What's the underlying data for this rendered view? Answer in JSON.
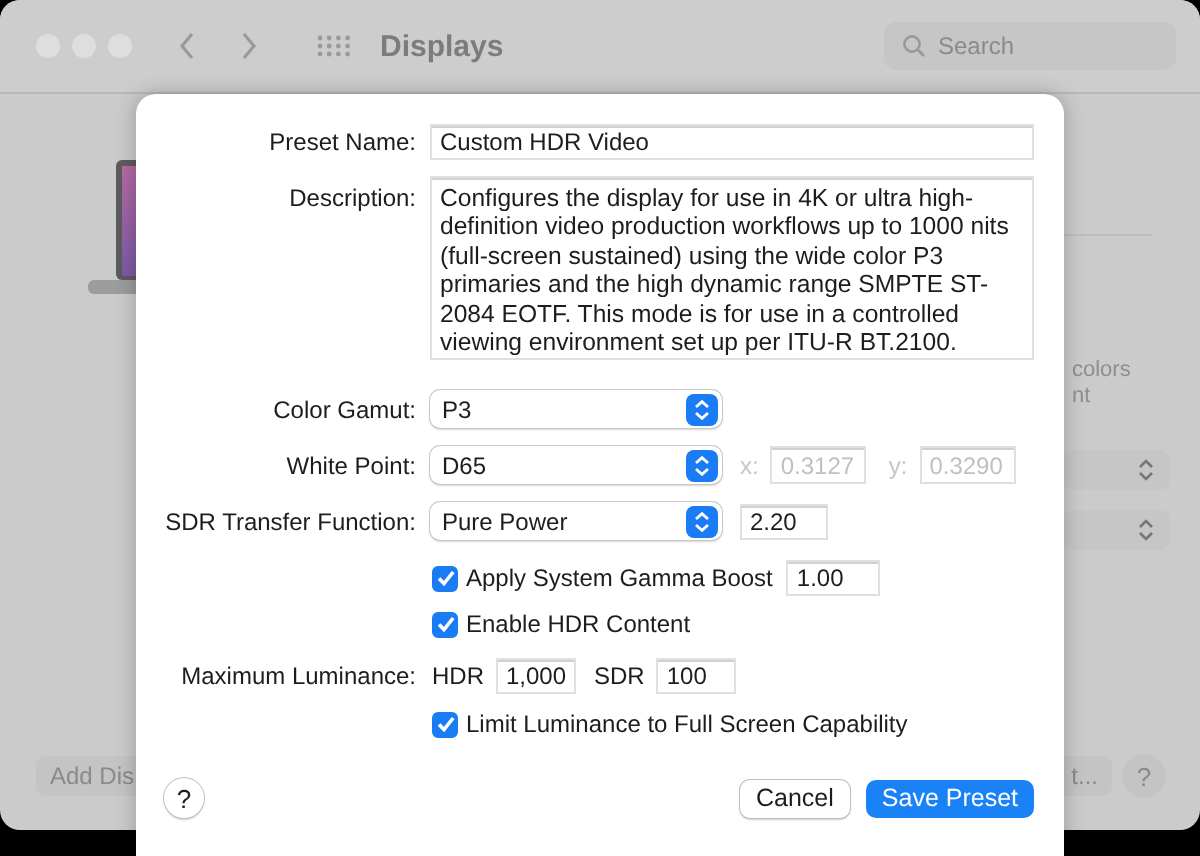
{
  "window": {
    "title": "Displays",
    "search": {
      "placeholder": "Search"
    }
  },
  "background": {
    "texts": [
      "colors",
      "nt"
    ],
    "buttons": [
      "Add Dis",
      "t..."
    ],
    "help": "?"
  },
  "dialog": {
    "preset_name": {
      "label": "Preset Name:",
      "value": "Custom HDR Video"
    },
    "description": {
      "label": "Description:",
      "value": "Configures the display for use in 4K or ultra high-definition video production workflows up to 1000 nits (full-screen sustained) using the wide color P3 primaries and the high dynamic range SMPTE ST-2084 EOTF. This mode is for use in a controlled viewing environment set up per ITU-R BT.2100."
    },
    "color_gamut": {
      "label": "Color Gamut:",
      "value": "P3"
    },
    "white_point": {
      "label": "White Point:",
      "value": "D65",
      "disabled": true,
      "x_label": "x:",
      "x_value": "0.3127",
      "y_label": "y:",
      "y_value": "0.3290"
    },
    "sdr_transfer": {
      "label": "SDR Transfer Function:",
      "value": "Pure Power",
      "gamma": "2.20"
    },
    "gamma_boost": {
      "label": "Apply System Gamma Boost",
      "checked": true,
      "value": "1.00"
    },
    "enable_hdr": {
      "label": "Enable HDR Content",
      "checked": true
    },
    "max_luminance": {
      "label": "Maximum Luminance:",
      "hdr_label": "HDR",
      "hdr_value": "1,000",
      "sdr_label": "SDR",
      "sdr_value": "100"
    },
    "limit_luminance": {
      "label": "Limit Luminance to Full Screen Capability",
      "checked": true
    },
    "help": "?",
    "buttons": [
      {
        "label": "Cancel",
        "primary": false
      },
      {
        "label": "Save Preset",
        "primary": true
      }
    ]
  }
}
